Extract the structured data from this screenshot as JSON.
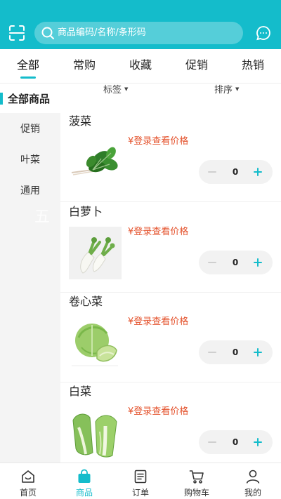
{
  "header": {
    "search_placeholder": "商品编码/名称/条形码",
    "scan_icon": "scan-icon",
    "message_icon": "message-icon"
  },
  "tabs": [
    {
      "label": "全部",
      "active": true
    },
    {
      "label": "常购"
    },
    {
      "label": "收藏"
    },
    {
      "label": "促销"
    },
    {
      "label": "热销"
    }
  ],
  "sidebar": {
    "title": "全部商品",
    "items": [
      {
        "label": "促销"
      },
      {
        "label": "叶菜"
      },
      {
        "label": "通用"
      }
    ]
  },
  "filters": {
    "tag_label": "标签",
    "sort_label": "排序"
  },
  "products": [
    {
      "name": "菠菜",
      "price_text": "¥登录查看价格",
      "quantity": "0"
    },
    {
      "name": "白萝卜",
      "price_text": "¥登录查看价格",
      "quantity": "0"
    },
    {
      "name": "卷心菜",
      "price_text": "¥登录查看价格",
      "quantity": "0"
    },
    {
      "name": "白菜",
      "price_text": "¥登录查看价格",
      "quantity": "0"
    }
  ],
  "watermark": "五",
  "bottom_nav": [
    {
      "label": "首页",
      "icon": "home-icon"
    },
    {
      "label": "商品",
      "icon": "shopping-bag-icon",
      "active": true
    },
    {
      "label": "订单",
      "icon": "order-icon"
    },
    {
      "label": "购物车",
      "icon": "cart-icon"
    },
    {
      "label": "我的",
      "icon": "user-icon"
    }
  ],
  "colors": {
    "accent": "#14bccb",
    "price": "#e4502a"
  }
}
